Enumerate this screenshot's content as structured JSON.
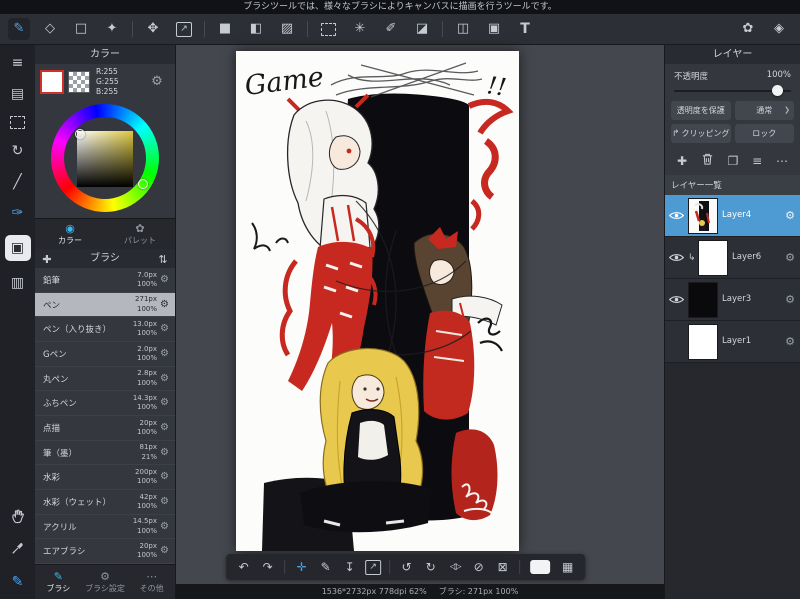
{
  "header": {
    "tooltip": "ブラシツールでは、様々なブラシによりキャンバスに描画を行うツールです。"
  },
  "icons": {
    "brush_tool": "✎",
    "eraser_tool": "◇",
    "shape_tool": "□",
    "scatter_tool": "✦",
    "move_tool": "✥",
    "transform_tool": "↗",
    "fill_tool": "■",
    "bucket_tool": "◧",
    "gradient_tool": "▨",
    "wand_tool": "✳",
    "select_pen_tool": "✐",
    "select_eraser_tool": "◪",
    "divide_tool": "◫",
    "select_move_tool": "▣",
    "text_tool": "T",
    "palette_switch": "✿",
    "layer_switch": "◈",
    "menu": "≡",
    "document": "▤",
    "rotate_view": "↻",
    "ruler": "╱",
    "brush_edit": "✑",
    "panel_active": "▣",
    "materials": "▥",
    "pen_small": "✎",
    "plus": "✚",
    "duplicate": "❐",
    "list": "≡",
    "more": "⋯",
    "sort": "⇅",
    "gear": "⚙",
    "chevron": "❯",
    "clip": "↳",
    "clip_btn": "↱",
    "undo": "↶",
    "redo": "↷",
    "cross": "✛",
    "download": "↧",
    "export": "↗",
    "rotate_ccw": "↺",
    "rotate_cw": "↻",
    "flip": "◁▷",
    "hide": "⊘",
    "clear": "⊠",
    "grid": "▦",
    "tab_color_icon": "◉",
    "tab_palette_icon": "✿",
    "tab_brush_icon": "✎",
    "tab_settings_icon": "⚙",
    "tab_other_icon": "⋯"
  },
  "color_panel": {
    "title": "カラー",
    "r": "R:255",
    "g": "G:255",
    "b": "B:255",
    "tab_color": "カラー",
    "tab_palette": "パレット"
  },
  "brush_panel": {
    "title": "ブラシ",
    "brushes": [
      {
        "name": "鉛筆",
        "size": "7.0px",
        "opacity": "100%"
      },
      {
        "name": "ペン",
        "size": "271px",
        "opacity": "100%"
      },
      {
        "name": "ペン（入り抜き）",
        "size": "13.0px",
        "opacity": "100%"
      },
      {
        "name": "Gペン",
        "size": "2.0px",
        "opacity": "100%"
      },
      {
        "name": "丸ペン",
        "size": "2.8px",
        "opacity": "100%"
      },
      {
        "name": "ふちペン",
        "size": "14.3px",
        "opacity": "100%"
      },
      {
        "name": "点描",
        "size": "20px",
        "opacity": "100%"
      },
      {
        "name": "筆（墨）",
        "size": "81px",
        "opacity": "21%"
      },
      {
        "name": "水彩",
        "size": "200px",
        "opacity": "100%"
      },
      {
        "name": "水彩（ウェット）",
        "size": "42px",
        "opacity": "100%"
      },
      {
        "name": "アクリル",
        "size": "14.5px",
        "opacity": "100%"
      },
      {
        "name": "エアブラシ",
        "size": "20px",
        "opacity": "100%"
      }
    ],
    "tab_brush": "ブラシ",
    "tab_settings": "ブラシ設定",
    "tab_other": "その他"
  },
  "canvas": {
    "title_text": "Game",
    "exclaim": "!!"
  },
  "statusbar": {
    "info": "1536*2732px 778dpi 62%",
    "brush_info": "ブラシ: 271px 100%"
  },
  "layer_panel": {
    "title": "レイヤー",
    "opacity_label": "不透明度",
    "opacity_value": "100%",
    "protect": "透明度を保護",
    "blend": "通常",
    "clipping": "クリッピング",
    "lock": "ロック",
    "list_title": "レイヤー一覧",
    "layers": [
      {
        "name": "Layer4"
      },
      {
        "name": "Layer6"
      },
      {
        "name": "Layer3"
      },
      {
        "name": "Layer1"
      }
    ]
  }
}
